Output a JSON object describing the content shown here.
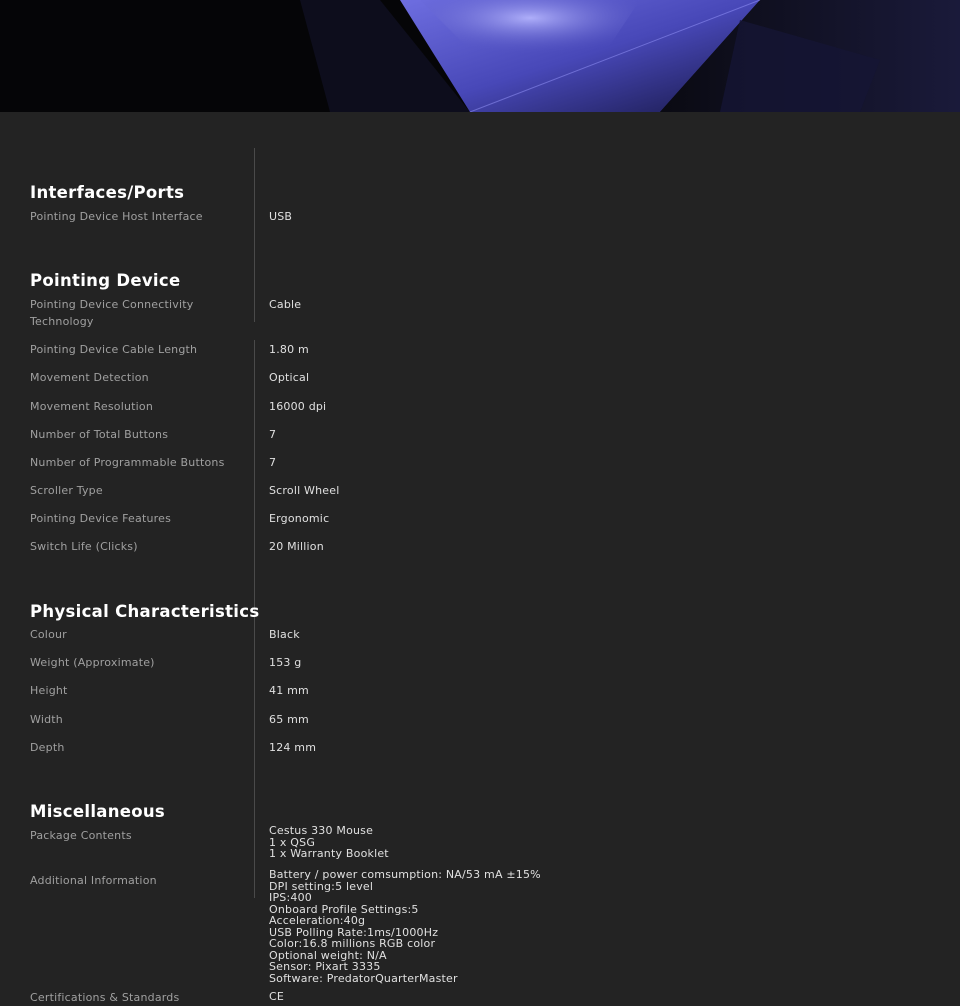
{
  "sections": [
    {
      "title": "Interfaces/Ports",
      "rows": [
        {
          "label": "Pointing Device Host Interface",
          "value": "USB"
        }
      ]
    },
    {
      "title": "Pointing Device",
      "rows": [
        {
          "label": "Pointing Device Connectivity Technology",
          "value": "Cable"
        },
        {
          "label": "Pointing Device Cable Length",
          "value": "1.80 m"
        },
        {
          "label": "Movement Detection",
          "value": "Optical"
        },
        {
          "label": "Movement Resolution",
          "value": "16000 dpi"
        },
        {
          "label": "Number of Total Buttons",
          "value": "7"
        },
        {
          "label": "Number of Programmable Buttons",
          "value": "7"
        },
        {
          "label": "Scroller Type",
          "value": "Scroll Wheel"
        },
        {
          "label": "Pointing Device Features",
          "value": "Ergonomic"
        },
        {
          "label": "Switch Life (Clicks)",
          "value": "20 Million"
        }
      ]
    },
    {
      "title": "Physical Characteristics",
      "rows": [
        {
          "label": "Colour",
          "value": "Black"
        },
        {
          "label": "Weight (Approximate)",
          "value": "153 g"
        },
        {
          "label": "Height",
          "value": "41 mm"
        },
        {
          "label": "Width",
          "value": "65 mm"
        },
        {
          "label": "Depth",
          "value": "124 mm"
        }
      ]
    },
    {
      "title": "Miscellaneous",
      "rows": [
        {
          "label": "Package Contents",
          "lines": [
            "Cestus 330 Mouse",
            "1 x QSG",
            "1 x Warranty Booklet"
          ]
        },
        {
          "label": "Additional Information",
          "lines": [
            "Battery / power comsumption: NA/53 mA ±15%",
            "DPI setting:5 level",
            "IPS:400",
            "Onboard Profile Settings:5",
            "Acceleration:40g",
            "USB Polling Rate:1ms/1000Hz",
            "Color:16.8 millions RGB color",
            "Optional weight: N/A",
            "Sensor: Pixart 3335",
            "Software: PredatorQuarterMaster"
          ]
        },
        {
          "label": "Certifications & Standards",
          "value": "CE"
        }
      ]
    }
  ]
}
